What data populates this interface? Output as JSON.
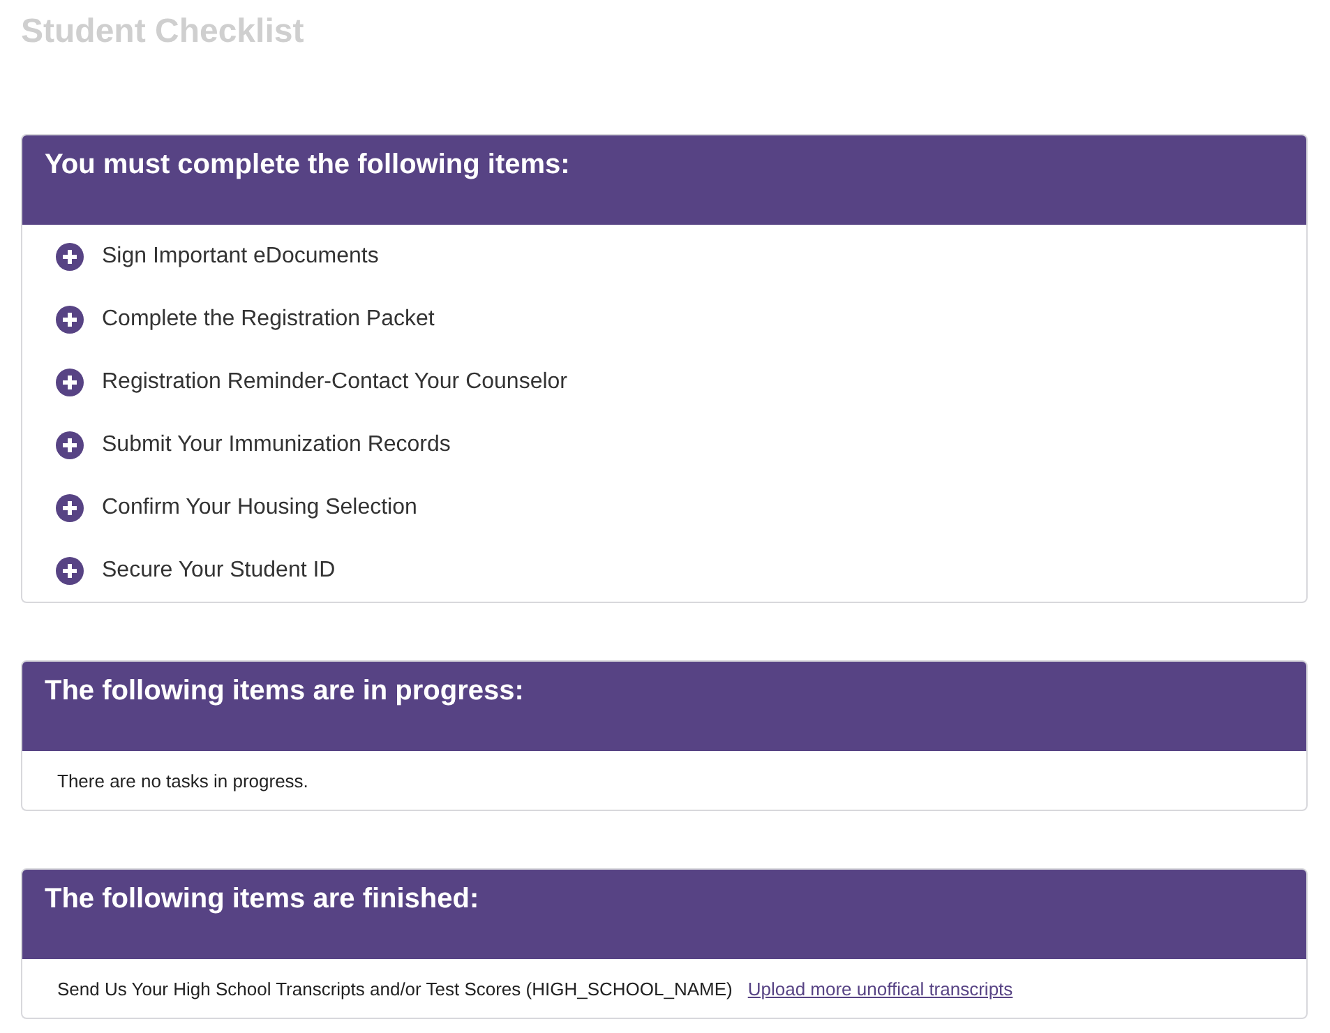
{
  "page_title": "Student Checklist",
  "sections": [
    {
      "kind": "tasks",
      "title": "You must complete the following items:",
      "items": [
        {
          "label": "Sign Important eDocuments"
        },
        {
          "label": "Complete the Registration Packet"
        },
        {
          "label": "Registration Reminder-Contact Your Counselor"
        },
        {
          "label": "Submit Your Immunization Records"
        },
        {
          "label": "Confirm Your Housing Selection"
        },
        {
          "label": "Secure Your Student ID"
        }
      ]
    },
    {
      "kind": "message",
      "title": "The following items are in progress:",
      "message": "There are no tasks in progress."
    },
    {
      "kind": "finished",
      "title": "The following items are finished:",
      "items": [
        {
          "label": "Send Us Your High School Transcripts and/or Test Scores (HIGH_SCHOOL_NAME)",
          "link": "Upload more unoffical transcripts"
        }
      ]
    }
  ]
}
